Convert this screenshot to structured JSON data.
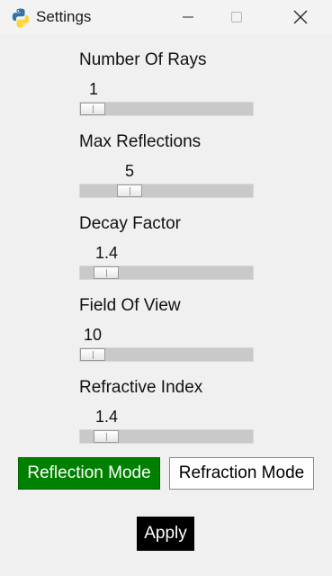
{
  "window": {
    "title": "Settings",
    "icon": "python-icon",
    "controls": [
      "minimize-icon",
      "maximize-icon",
      "close-icon"
    ]
  },
  "sliders": [
    {
      "label": "Number Of Rays",
      "value": "1",
      "fraction": 0.0
    },
    {
      "label": "Max Reflections",
      "value": "5",
      "fraction": 0.25
    },
    {
      "label": "Decay Factor",
      "value": "1.4",
      "fraction": 0.09
    },
    {
      "label": "Field Of View",
      "value": "10",
      "fraction": 0.0
    },
    {
      "label": "Refractive Index",
      "value": "1.4",
      "fraction": 0.09
    }
  ],
  "modes": {
    "reflection_label": "Reflection Mode",
    "refraction_label": "Refraction Mode",
    "active": "reflection"
  },
  "apply_label": "Apply",
  "colors": {
    "active_mode": "#008000",
    "apply_bg": "#000000",
    "trough": "#c9c9c9"
  }
}
